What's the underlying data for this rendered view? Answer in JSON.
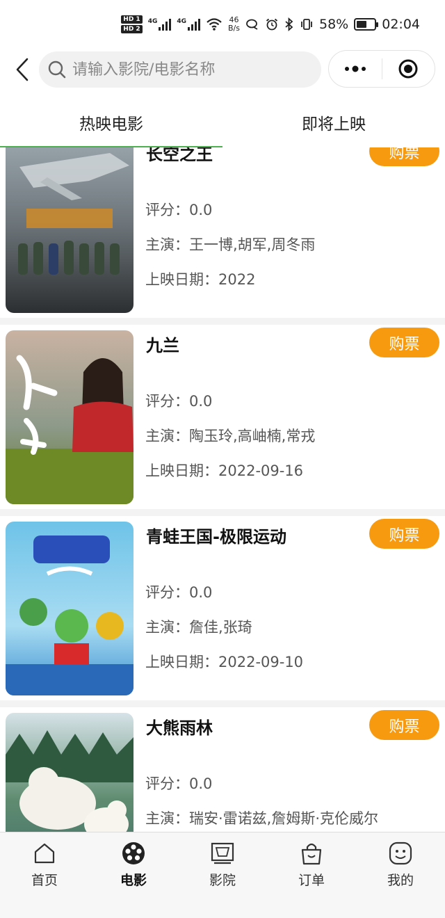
{
  "status_bar": {
    "hd1": "HD 1",
    "hd2": "HD 2",
    "net1": "4G",
    "net2": "4G",
    "speed_value": "46",
    "speed_unit": "B/s",
    "battery": "58%",
    "battery_level": 0.58,
    "time": "02:04"
  },
  "header": {
    "search_placeholder": "请输入影院/电影名称"
  },
  "tabs": [
    {
      "label": "热映电影",
      "active": true
    },
    {
      "label": "即将上映",
      "active": false
    }
  ],
  "labels": {
    "score": "评分：",
    "cast": "主演：",
    "release": "上映日期：",
    "buy": "购票"
  },
  "movies": [
    {
      "title": "长空之王",
      "score": "0.0",
      "cast": "王一博,胡军,周冬雨",
      "release": "2022"
    },
    {
      "title": "九兰",
      "score": "0.0",
      "cast": "陶玉玲,高岫楠,常戎",
      "release": "2022-09-16"
    },
    {
      "title": "青蛙王国-极限运动",
      "score": "0.0",
      "cast": "詹佳,张琦",
      "release": "2022-09-10"
    },
    {
      "title": "大熊雨林",
      "score": "0.0",
      "cast": "瑞安·雷诺兹,詹姆斯·克伦威尔",
      "release": ""
    }
  ],
  "bottom_nav": [
    {
      "label": "首页",
      "icon": "home-icon",
      "active": false
    },
    {
      "label": "电影",
      "icon": "film-reel-icon",
      "active": true
    },
    {
      "label": "影院",
      "icon": "cinema-screen-icon",
      "active": false
    },
    {
      "label": "订单",
      "icon": "shopping-bag-icon",
      "active": false
    },
    {
      "label": "我的",
      "icon": "smiley-user-icon",
      "active": false
    }
  ],
  "colors": {
    "accent_green": "#4caf50",
    "buy_orange": "#f79a10"
  }
}
